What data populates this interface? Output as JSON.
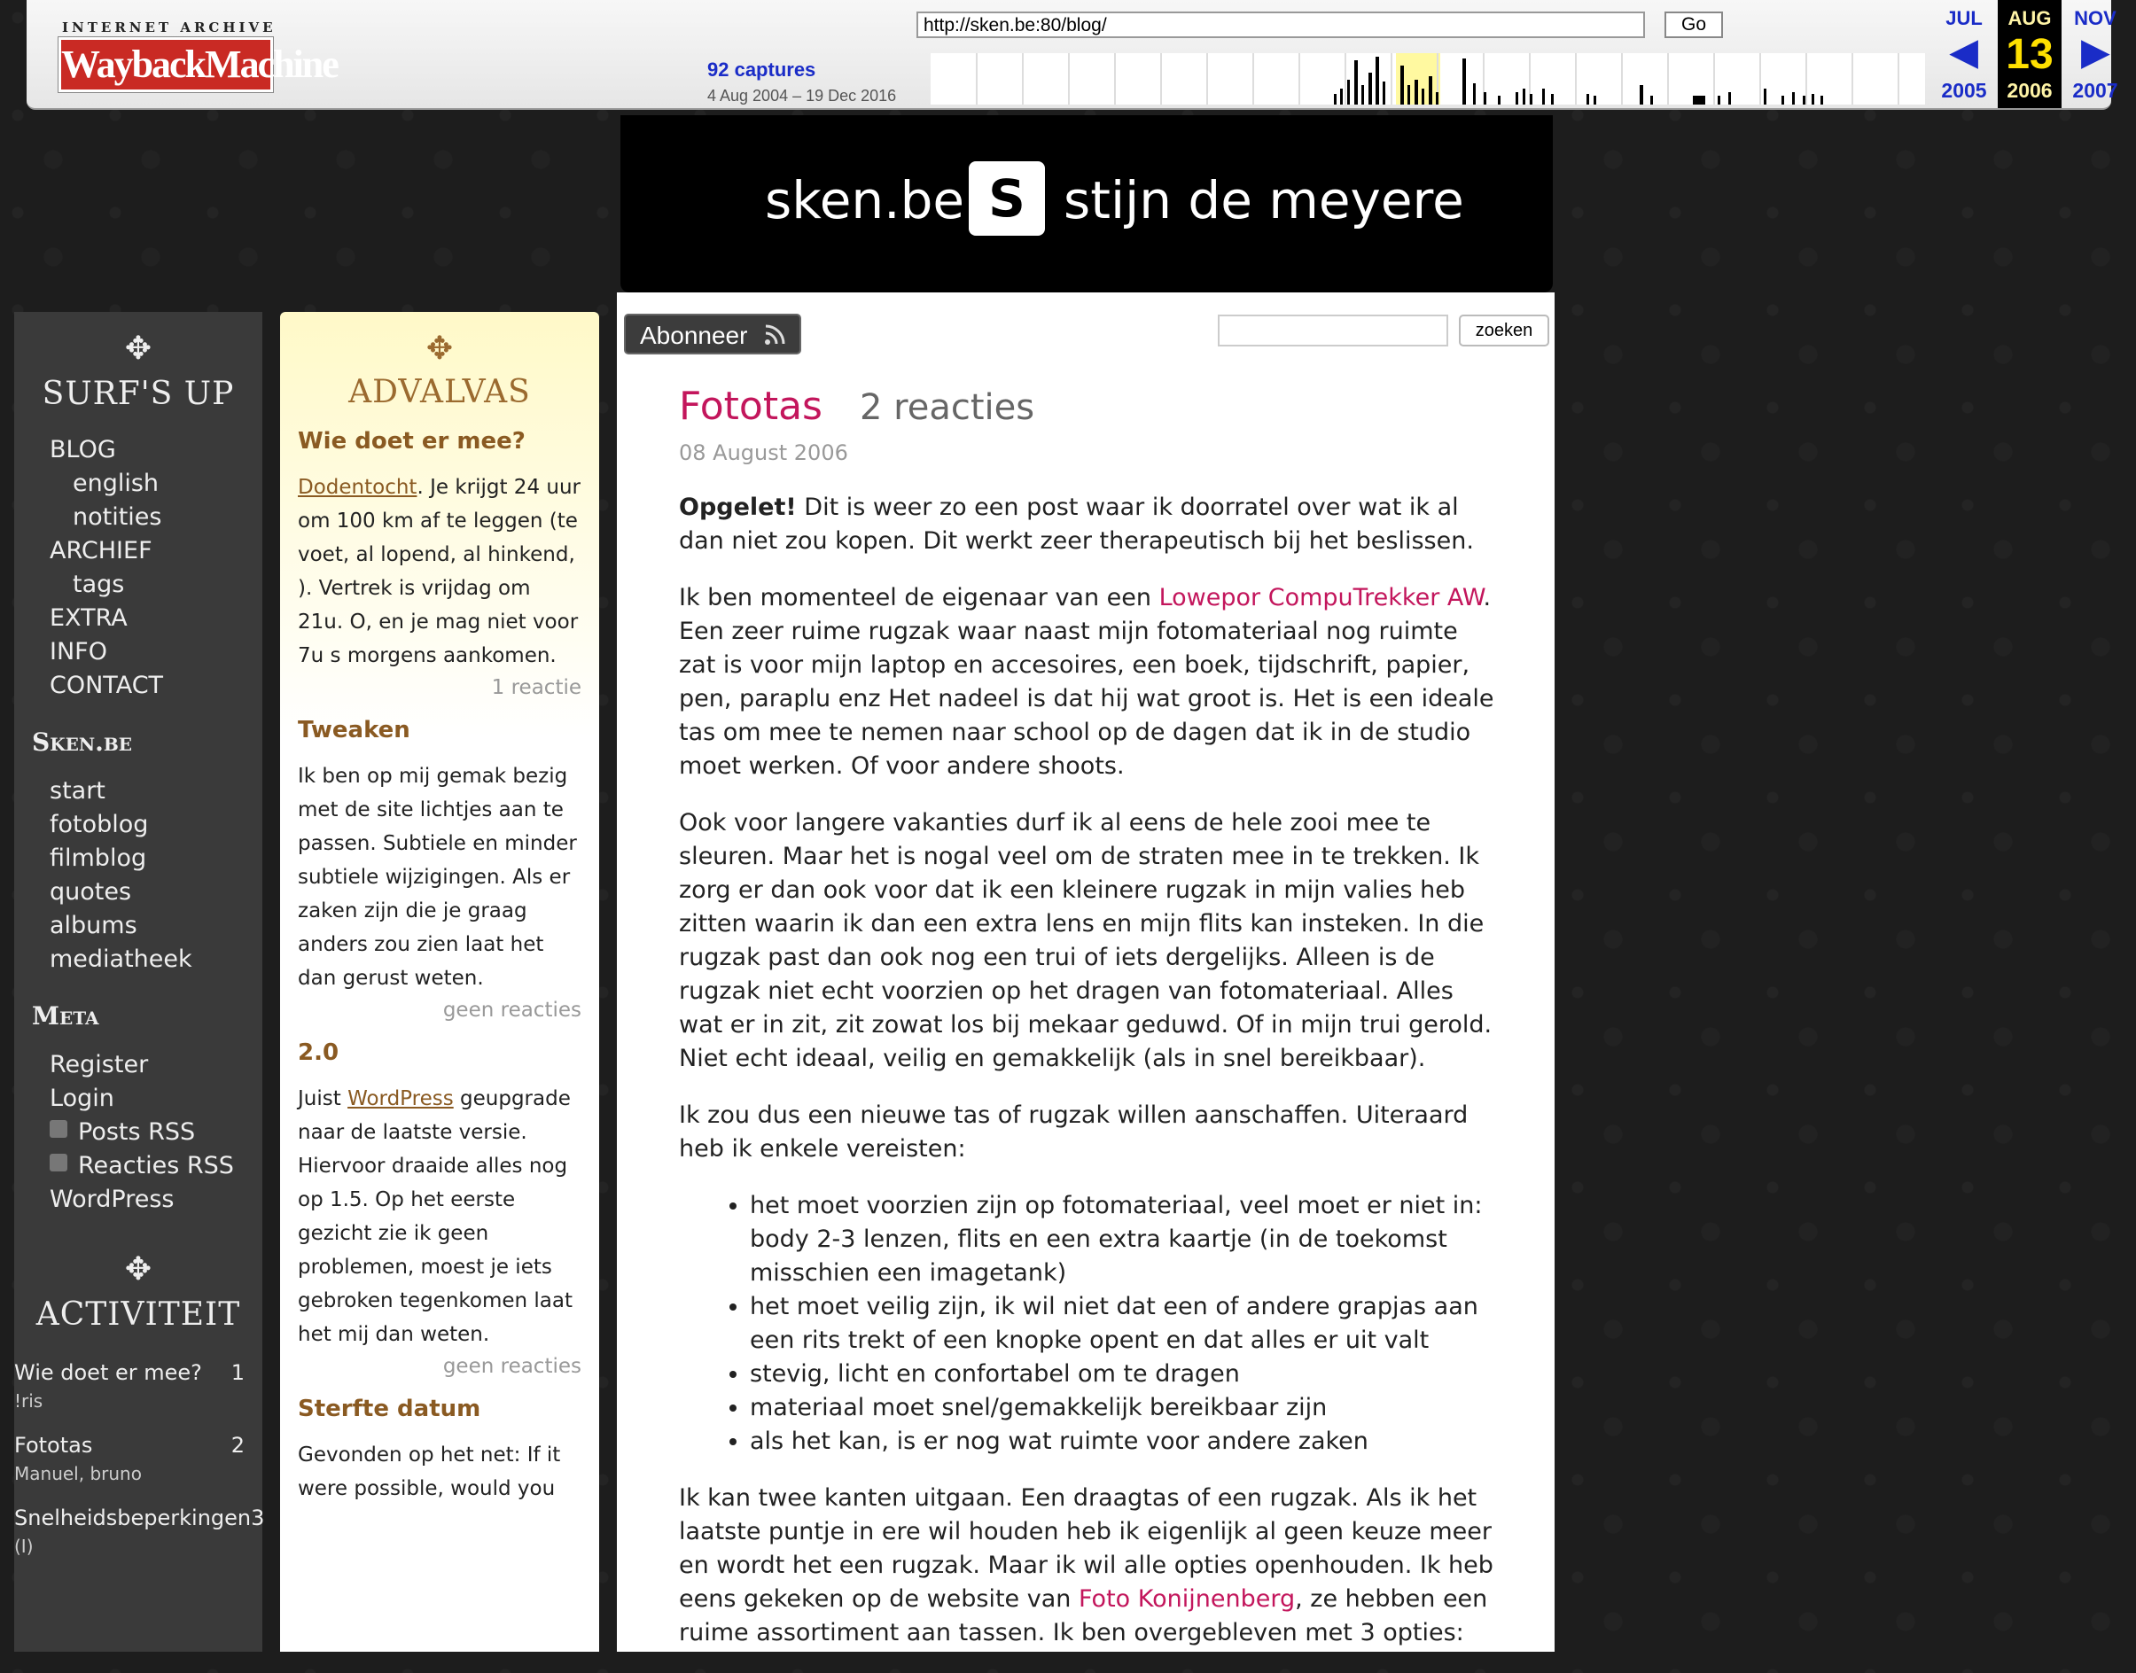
{
  "wayback": {
    "logo_top": "INTERNET ARCHIVE",
    "logo_main": "WaybackMachine",
    "url": "http://sken.be:80/blog/",
    "go_label": "Go",
    "captures": "92 captures",
    "range": "4 Aug 2004 – 19 Dec 2016",
    "prev_month": "JUL",
    "prev_year": "2005",
    "cur_month": "AUG",
    "cur_day": "13",
    "cur_year": "2006",
    "next_month": "NOV",
    "next_year": "2007"
  },
  "banner": {
    "site": "sken.be",
    "letter": "S",
    "name": "stijn de meyere"
  },
  "toolbar": {
    "subscribe_label": "Abonneer",
    "search_button": "zoeken",
    "search_placeholder": ""
  },
  "post": {
    "title": "Fototas",
    "comments": "2 reacties",
    "date": "08 August 2006",
    "p1_strong": "Opgelet!",
    "p1_rest": " Dit is weer zo een post waar ik doorratel over wat ik al dan niet zou kopen. Dit werkt zeer therapeutisch bij het beslissen.",
    "p2_a": "Ik ben momenteel de eigenaar van een ",
    "p2_link": "Lowepor CompuTrekker AW",
    "p2_b": ". Een zeer ruime rugzak waar naast mijn fotomateriaal nog ruimte zat is voor mijn laptop en accesoires, een boek, tijdschrift, papier, pen, paraplu enz Het nadeel is dat hij wat groot is. Het is een ideale tas om mee te nemen naar school op de dagen dat ik in de studio moet werken. Of voor andere shoots.",
    "p3": "Ook voor langere vakanties durf ik al eens de hele zooi mee te sleuren. Maar het is nogal veel om de straten mee in te trekken. Ik zorg er dan ook voor dat ik een kleinere rugzak in mijn valies heb zitten waarin ik dan een extra lens en mijn flits kan insteken. In die rugzak past dan ook nog een trui of iets dergelijks. Alleen is de rugzak niet echt voorzien op het dragen van fotomateriaal. Alles wat er in zit, zit zowat los bij mekaar geduwd. Of in mijn trui gerold. Niet echt ideaal, veilig en gemakkelijk (als in snel bereikbaar).",
    "p4": "Ik zou dus een nieuwe tas of rugzak willen aanschaffen. Uiteraard heb ik enkele vereisten:",
    "bullets": [
      "het moet voorzien zijn op fotomateriaal, veel moet er niet in: body 2-3 lenzen, flits en een extra kaartje (in de toekomst misschien een imagetank)",
      "het moet veilig zijn, ik wil niet dat een of andere grapjas aan een rits trekt of een knopke opent en dat alles er uit valt",
      "stevig, licht en confortabel om te dragen",
      "materiaal moet snel/gemakkelijk bereikbaar zijn",
      "als het kan, is er nog wat ruimte voor andere zaken"
    ],
    "p5_a": "Ik kan twee kanten uitgaan. Een draagtas of een rugzak. Als ik het laatste puntje in ere wil houden heb ik eigenlijk al geen keuze meer en wordt het een rugzak. Maar ik wil alle opties openhouden. Ik heb eens gekeken op de website van ",
    "p5_link": "Foto Konijnenberg",
    "p5_b": ", ze hebben een ruime assortiment aan tassen. Ik ben overgebleven met 3 opties:"
  },
  "left": {
    "title": "SURF'S UP",
    "nav": [
      "BLOG",
      "english",
      "notities",
      "ARCHIEF",
      "tags",
      "EXTRA",
      "INFO",
      "CONTACT"
    ],
    "sken_title": "Sken.be",
    "sken_links": [
      "start",
      "fotoblog",
      "filmblog",
      "quotes",
      "albums",
      "mediatheek"
    ],
    "meta_title": "Meta",
    "meta_links": [
      "Register",
      "Login",
      "Posts RSS",
      "Reacties RSS",
      "WordPress"
    ],
    "act_title": "ACTIVITEIT",
    "activity": [
      {
        "title": "Wie doet er mee?",
        "count": "1",
        "who": "!ris"
      },
      {
        "title": "Fototas",
        "count": "2",
        "who": "Manuel, bruno"
      },
      {
        "title": "Snelheidsbeperkingen",
        "count": "3",
        "who": "(I)"
      }
    ]
  },
  "adv": {
    "title": "ADVALVAS",
    "items": [
      {
        "h": "Wie doet er mee?",
        "link": "Dodentocht",
        "text": ". Je krijgt 24 uur om 100 km af te leggen (te voet, al lopend, al hinkend, ). Vertrek is vrijdag om 21u. O, en je mag niet voor 7u s morgens aankomen.",
        "meta": "1 reactie"
      },
      {
        "h": "Tweaken",
        "text": "Ik ben op mij gemak bezig met de site lichtjes aan te passen. Subtiele en minder subtiele wijzigingen. Als er zaken zijn die je graag anders zou zien laat het dan gerust weten.",
        "meta": "geen reacties"
      },
      {
        "h": "2.0",
        "pre": "Juist ",
        "link": "WordPress",
        "text": " geupgrade naar de laatste versie. Hiervoor draaide alles nog op 1.5. Op het eerste gezicht zie ik geen problemen, moest je iets gebroken tegenkomen laat het mij dan weten.",
        "meta": "geen reacties"
      },
      {
        "h": "Sterfte datum",
        "text": "Gevonden op het net: If it were possible, would you"
      }
    ]
  }
}
